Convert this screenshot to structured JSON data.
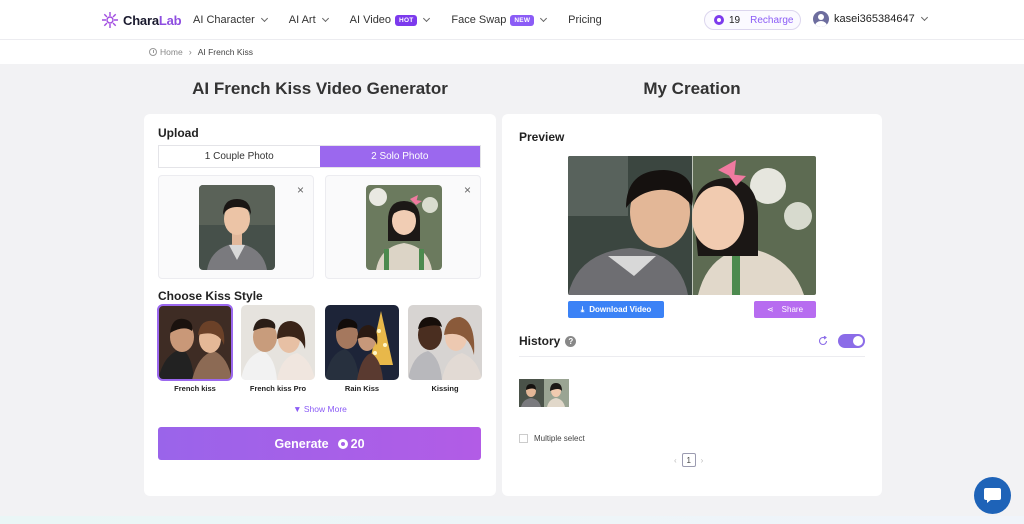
{
  "header": {
    "logo_main": "Chara",
    "logo_accent": "Lab",
    "nav": [
      {
        "label": "AI Character",
        "badge": ""
      },
      {
        "label": "AI Art",
        "badge": ""
      },
      {
        "label": "AI Video",
        "badge": "HOT"
      },
      {
        "label": "Face Swap",
        "badge": "NEW"
      },
      {
        "label": "Pricing",
        "badge": ""
      }
    ],
    "credits": "19",
    "recharge": "Recharge",
    "username": "kasei365384647"
  },
  "breadcrumb": {
    "home": "Home",
    "current": "AI French Kiss"
  },
  "left": {
    "title": "AI French Kiss Video Generator",
    "upload_label": "Upload",
    "tab_couple": "1 Couple Photo",
    "tab_solo": "2 Solo Photo",
    "close_glyph": "×",
    "choose_label": "Choose Kiss Style",
    "styles": [
      {
        "label": "French kiss"
      },
      {
        "label": "French kiss Pro"
      },
      {
        "label": "Rain Kiss"
      },
      {
        "label": "Kissing"
      }
    ],
    "show_more": "Show More",
    "generate_label": "Generate",
    "generate_cost": "20"
  },
  "right": {
    "title": "My Creation",
    "preview_label": "Preview",
    "download_label": "Download Video",
    "share_label": "Share",
    "history_label": "History",
    "help_glyph": "?",
    "multiple_select": "Multiple select",
    "page_current": "1"
  },
  "colors": {
    "accent": "#9b68ee",
    "download": "#3b82f6",
    "chat": "#1e63b8"
  }
}
